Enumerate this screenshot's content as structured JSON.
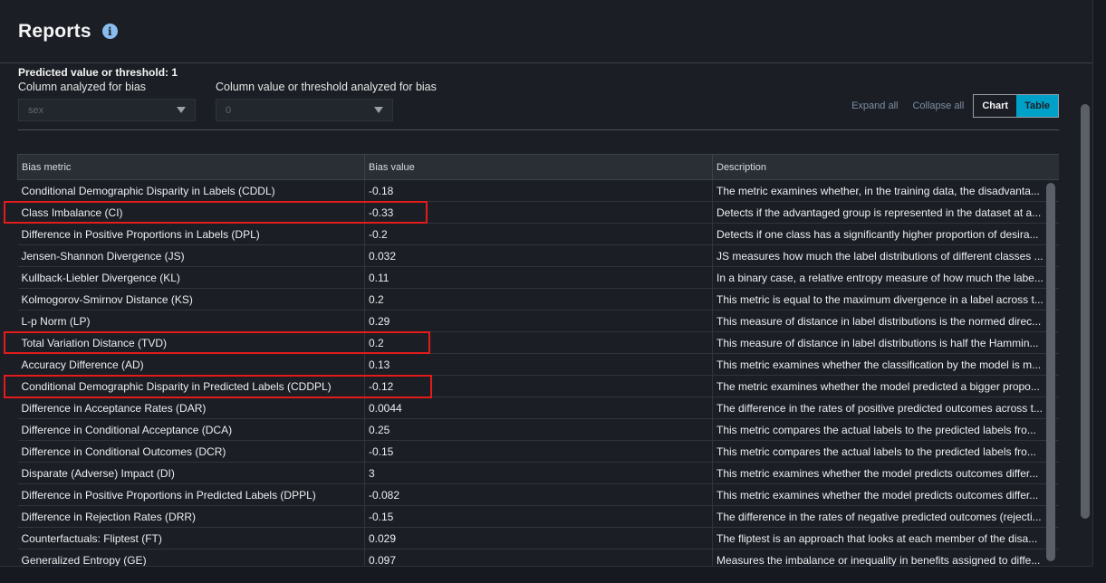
{
  "header": {
    "title": "Reports",
    "info_icon": "info-icon"
  },
  "controls": {
    "predicted_label": "Predicted value or threshold: 1",
    "column_label": "Column analyzed for bias",
    "column_value": "sex",
    "value_label": "Column value or threshold analyzed for bias",
    "value_value": "0",
    "expand_all": "Expand all",
    "collapse_all": "Collapse all",
    "chart_label": "Chart",
    "table_label": "Table"
  },
  "table": {
    "headers": [
      "Bias metric",
      "Bias value",
      "Description"
    ],
    "rows": [
      {
        "metric": "Conditional Demographic Disparity in Labels (CDDL)",
        "value": "-0.18",
        "description": "The metric examines whether, in the training data, the disadvanta..."
      },
      {
        "metric": "Class Imbalance (CI)",
        "value": "-0.33",
        "description": "Detects if the advantaged group is represented in the dataset at a..."
      },
      {
        "metric": "Difference in Positive Proportions in Labels (DPL)",
        "value": "-0.2",
        "description": "Detects if one class has a significantly higher proportion of desira..."
      },
      {
        "metric": "Jensen-Shannon Divergence (JS)",
        "value": "0.032",
        "description": "JS measures how much the label distributions of different classes ..."
      },
      {
        "metric": "Kullback-Liebler Divergence (KL)",
        "value": "0.11",
        "description": "In a binary case, a relative entropy measure of how much the labe..."
      },
      {
        "metric": "Kolmogorov-Smirnov Distance (KS)",
        "value": "0.2",
        "description": "This metric is equal to the maximum divergence in a label across t..."
      },
      {
        "metric": "L-p Norm (LP)",
        "value": "0.29",
        "description": "This measure of distance in label distributions is the normed direc..."
      },
      {
        "metric": "Total Variation Distance (TVD)",
        "value": "0.2",
        "description": "This measure of distance in label distributions is half the Hammin..."
      },
      {
        "metric": "Accuracy Difference (AD)",
        "value": "0.13",
        "description": "This metric examines whether the classification by the model is m..."
      },
      {
        "metric": "Conditional Demographic Disparity in Predicted Labels (CDDPL)",
        "value": "-0.12",
        "description": "The metric examines whether the model predicted a bigger propo..."
      },
      {
        "metric": "Difference in Acceptance Rates (DAR)",
        "value": "0.0044",
        "description": "The difference in the rates of positive predicted outcomes across t..."
      },
      {
        "metric": "Difference in Conditional Acceptance (DCA)",
        "value": "0.25",
        "description": "This metric compares the actual labels to the predicted labels fro..."
      },
      {
        "metric": "Difference in Conditional Outcomes (DCR)",
        "value": "-0.15",
        "description": "This metric compares the actual labels to the predicted labels fro..."
      },
      {
        "metric": "Disparate (Adverse) Impact (DI)",
        "value": "3",
        "description": "This metric examines whether the model predicts outcomes differ..."
      },
      {
        "metric": "Difference in Positive Proportions in Predicted Labels (DPPL)",
        "value": "-0.082",
        "description": "This metric examines whether the model predicts outcomes differ..."
      },
      {
        "metric": "Difference in Rejection Rates (DRR)",
        "value": "-0.15",
        "description": "The difference in the rates of negative predicted outcomes (rejecti..."
      },
      {
        "metric": "Counterfactuals: Fliptest (FT)",
        "value": "0.029",
        "description": "The fliptest is an approach that looks at each member of the disa..."
      },
      {
        "metric": "Generalized Entropy (GE)",
        "value": "0.097",
        "description": "Measures the imbalance or inequality in benefits assigned to diffe..."
      }
    ]
  },
  "colors": {
    "highlight": "#e21b1b",
    "table_toggle_active": "#00a1c9"
  }
}
